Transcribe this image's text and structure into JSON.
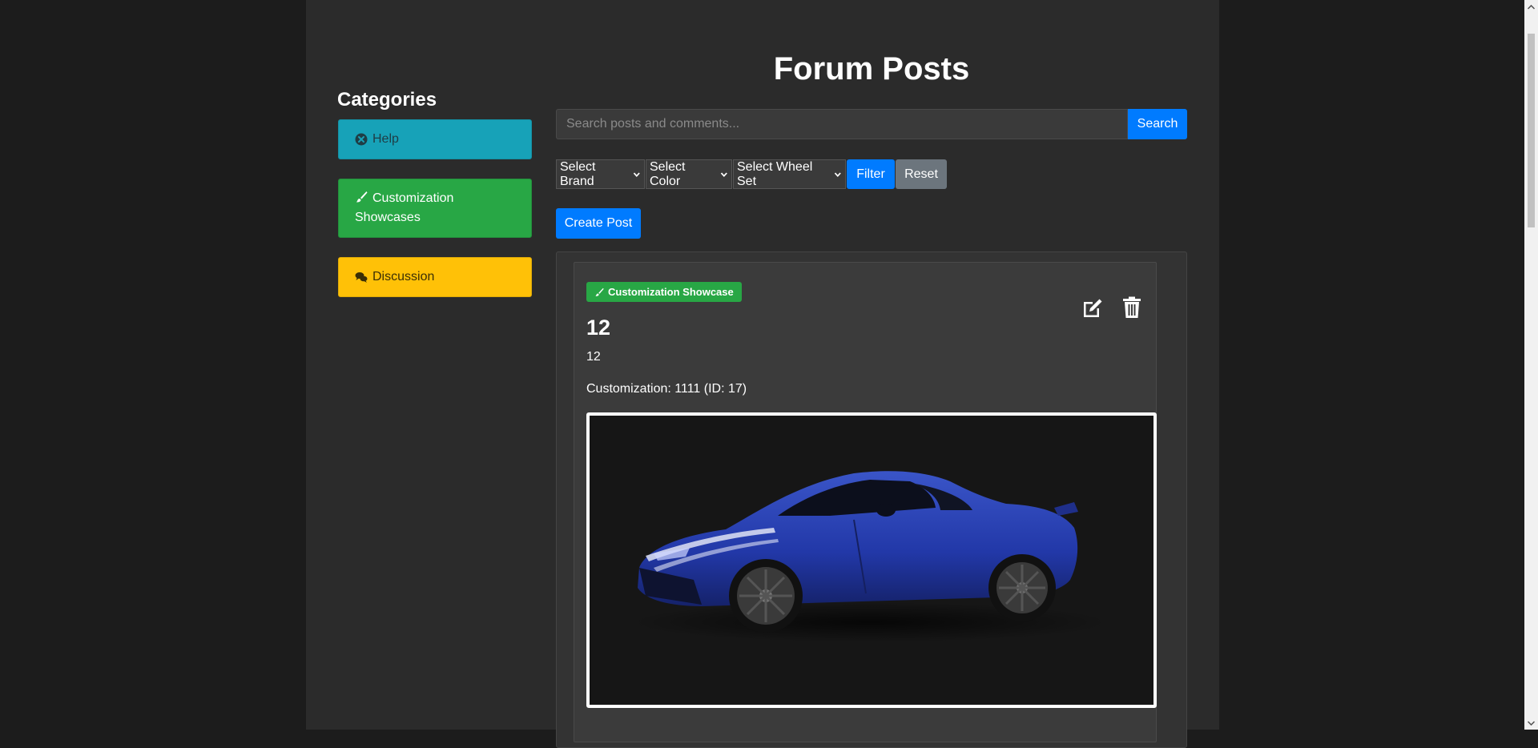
{
  "sidebar": {
    "title": "Categories",
    "items": [
      {
        "label": "Help",
        "icon": "times-circle-icon",
        "color": "#17a2b8"
      },
      {
        "label": "Customization Showcases",
        "icon": "paint-brush-icon",
        "color": "#28a745"
      },
      {
        "label": "Discussion",
        "icon": "comments-icon",
        "color": "#ffc107"
      }
    ]
  },
  "header": {
    "title": "Forum Posts"
  },
  "search": {
    "placeholder": "Search posts and comments...",
    "button_label": "Search"
  },
  "filters": {
    "brand": "Select Brand",
    "color": "Select Color",
    "wheel_set": "Select Wheel Set",
    "filter_label": "Filter",
    "reset_label": "Reset"
  },
  "actions": {
    "create_post_label": "Create Post"
  },
  "post": {
    "category_badge": "Customization Showcase",
    "title": "12",
    "body": "12",
    "customization": "Customization: 1111 (ID: 17)",
    "image_icon": "car-image"
  },
  "colors": {
    "primary": "#007bff",
    "secondary": "#6c757d",
    "success": "#28a745",
    "info": "#17a2b8",
    "warning": "#ffc107",
    "background": "#2b2b2b"
  }
}
